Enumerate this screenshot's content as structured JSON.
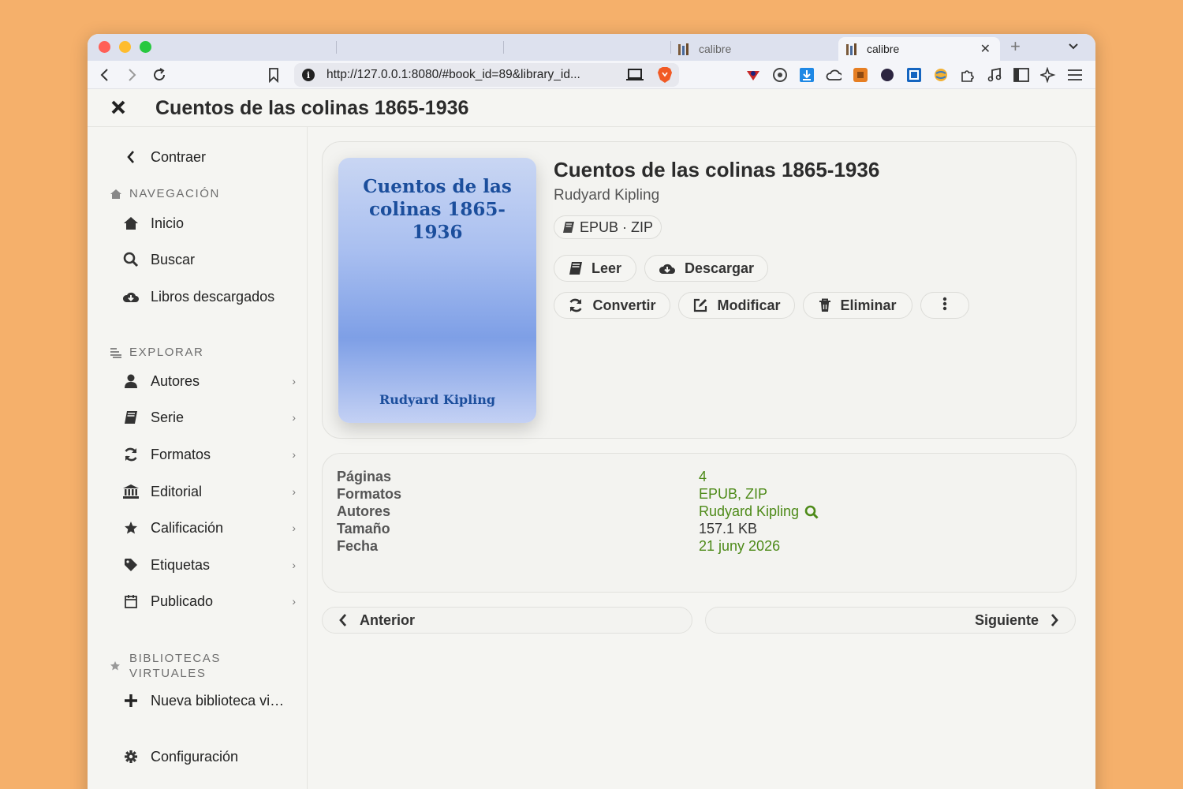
{
  "browser": {
    "tabs": [
      {
        "title": "calibre",
        "active": false
      },
      {
        "title": "calibre",
        "active": true
      }
    ],
    "url": "http://127.0.0.1:8080/#book_id=89&library_id..."
  },
  "header": {
    "title": "Cuentos de las colinas 1865-1936"
  },
  "sidebar": {
    "collapse_label": "Contraer",
    "nav_heading": "NAVEGACIÓN",
    "nav_items": [
      {
        "label": "Inicio",
        "icon": "home-icon"
      },
      {
        "label": "Buscar",
        "icon": "search-icon"
      },
      {
        "label": "Libros descargados",
        "icon": "cloud-download-icon"
      }
    ],
    "explore_heading": "EXPLORAR",
    "explore_items": [
      {
        "label": "Autores",
        "icon": "user-icon"
      },
      {
        "label": "Serie",
        "icon": "book-icon"
      },
      {
        "label": "Formatos",
        "icon": "refresh-icon"
      },
      {
        "label": "Editorial",
        "icon": "bank-icon"
      },
      {
        "label": "Calificación",
        "icon": "star-icon"
      },
      {
        "label": "Etiquetas",
        "icon": "tag-icon"
      },
      {
        "label": "Publicado",
        "icon": "calendar-icon"
      }
    ],
    "vl_heading_line1": "BIBLIOTECAS",
    "vl_heading_line2": "VIRTUALES",
    "new_vl_label": "Nueva biblioteca vi…",
    "settings_label": "Configuración"
  },
  "book": {
    "cover_title": "Cuentos de las colinas 1865-1936",
    "cover_author": "Rudyard Kipling",
    "title": "Cuentos de las colinas 1865-1936",
    "author": "Rudyard Kipling",
    "formats_pill": "EPUB · ZIP",
    "actions": {
      "read": "Leer",
      "download": "Descargar",
      "convert": "Convertir",
      "edit": "Modificar",
      "delete": "Eliminar"
    }
  },
  "metadata": [
    {
      "key": "Páginas",
      "value": "4",
      "style": "green"
    },
    {
      "key": "Formatos",
      "value": "EPUB, ZIP",
      "style": "green"
    },
    {
      "key": "Autores",
      "value": "Rudyard Kipling",
      "style": "green",
      "search": true
    },
    {
      "key": "Tamaño",
      "value": "157.1 KB",
      "style": "plain"
    },
    {
      "key": "Fecha",
      "value": "21 juny 2026",
      "style": "green"
    }
  ],
  "pagination": {
    "prev": "Anterior",
    "next": "Siguiente"
  },
  "colors": {
    "link_green": "#4d8a18",
    "cover_text": "#1b4e9c",
    "background": "#f5b06b"
  }
}
